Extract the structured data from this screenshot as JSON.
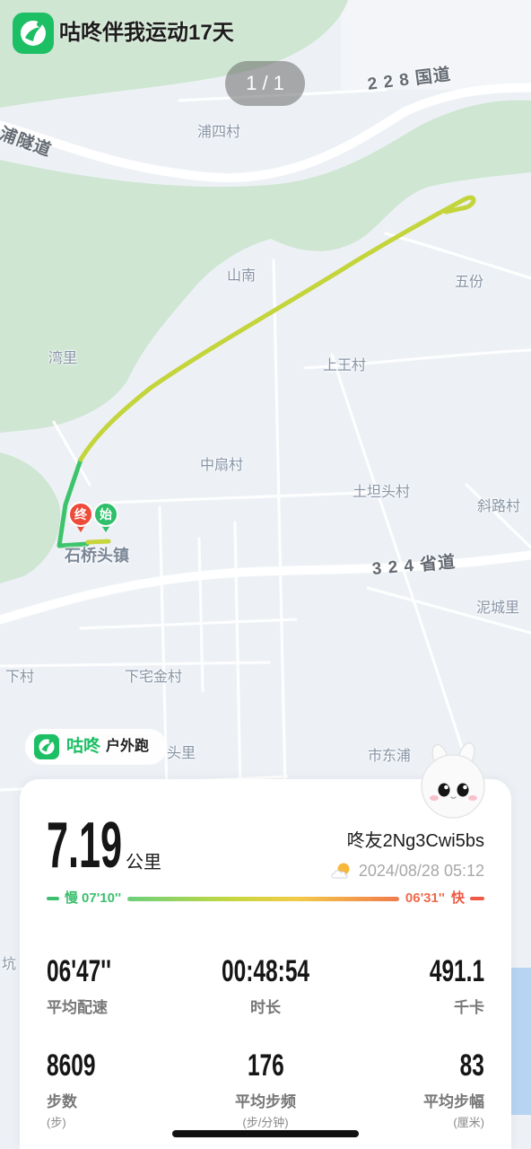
{
  "header": {
    "icon": "codoon-logo-icon",
    "title": "咕咚伴我运动17天"
  },
  "pager": {
    "label": "1 / 1"
  },
  "map": {
    "road_labels": [
      "2 2 8 国道",
      "浦隧道",
      "3 2 4 省道"
    ],
    "place_labels": [
      "浦四村",
      "山南",
      "五份",
      "湾里",
      "上王村",
      "中扇村",
      "土坦头村",
      "斜路村",
      "石桥头镇",
      "泥城里",
      "下村",
      "下宅金村",
      "头里",
      "市东浦",
      "坑"
    ],
    "markers": {
      "end": "终",
      "start": "始"
    }
  },
  "workout": {
    "brand_icon": "codoon-logo-icon",
    "brand": "咕咚",
    "type": "户外跑",
    "distance": "7.19",
    "distance_unit": "公里",
    "user": "咚友2Ng3Cwi5bs",
    "weather_icon": "partly-cloudy-icon",
    "datetime": "2024/08/28 05:12",
    "pace_scale": {
      "slow_label": "慢",
      "slowest": "07'10''",
      "fastest": "06'31''",
      "fast_label": "快"
    },
    "stats": [
      {
        "value": "06'47''",
        "label": "平均配速"
      },
      {
        "value": "00:48:54",
        "label": "时长"
      },
      {
        "value": "491.1",
        "label": "千卡"
      },
      {
        "value": "8609",
        "label": "步数",
        "unit": "(步)"
      },
      {
        "value": "176",
        "label": "平均步频",
        "unit": "(步/分钟)"
      },
      {
        "value": "83",
        "label": "平均步幅",
        "unit": "(厘米)"
      }
    ]
  },
  "avatar": {
    "icon": "bunny-avatar-icon"
  },
  "colors": {
    "brand": "#1dbf64",
    "route": "#c4d43b",
    "route_fast": "#3dc46b",
    "slow": "#3dbf6e",
    "fast": "#ee5a45",
    "end_marker": "#ee4c3b",
    "start_marker": "#2fbf6a"
  }
}
